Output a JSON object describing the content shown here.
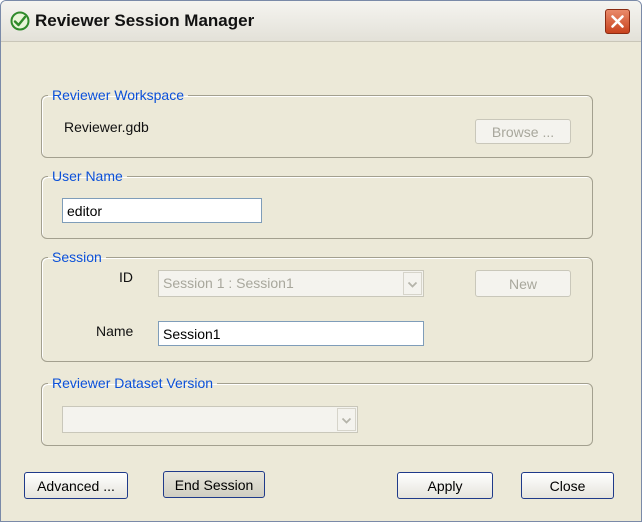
{
  "window": {
    "title": "Reviewer Session Manager",
    "icon": "check-circle-icon",
    "close_icon": "close-icon"
  },
  "workspace": {
    "legend": "Reviewer Workspace",
    "value": "Reviewer.gdb",
    "browse_label": "Browse ..."
  },
  "user": {
    "legend": "User Name",
    "value": "editor"
  },
  "session": {
    "legend": "Session",
    "id_label": "ID",
    "id_value": "Session 1 : Session1",
    "new_label": "New",
    "name_label": "Name",
    "name_value": "Session1"
  },
  "dataset": {
    "legend": "Reviewer Dataset Version",
    "value": ""
  },
  "buttons": {
    "advanced": "Advanced ...",
    "end_session": "End Session",
    "apply": "Apply",
    "close": "Close"
  },
  "colors": {
    "legend": "#0b50d8",
    "dialog_bg": "#ece9d8",
    "close_button": "#c8421d"
  }
}
